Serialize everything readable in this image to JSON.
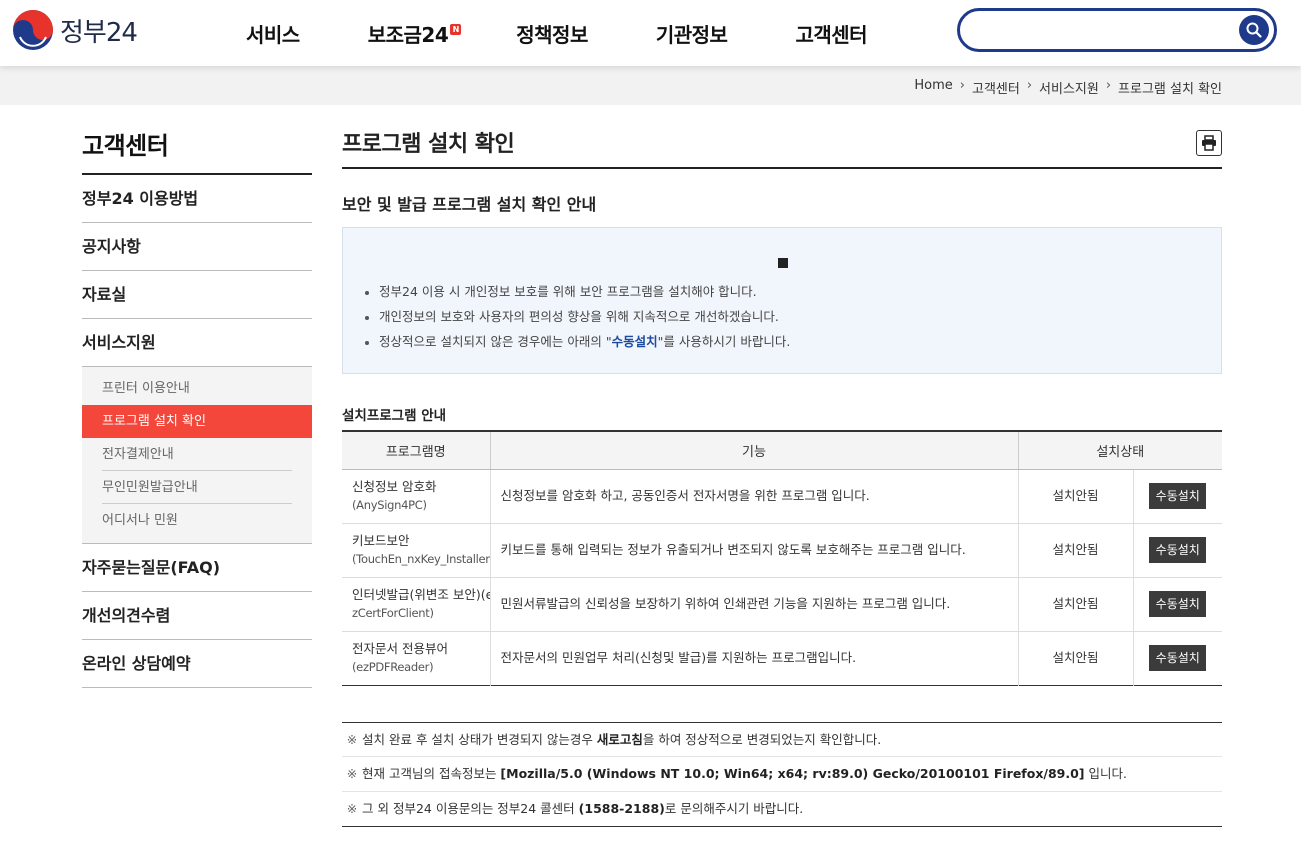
{
  "header": {
    "logo_text": "정부24",
    "nav": [
      {
        "label": "서비스",
        "badge": ""
      },
      {
        "label": "보조금24",
        "badge": "N"
      },
      {
        "label": "정책정보",
        "badge": ""
      },
      {
        "label": "기관정보",
        "badge": ""
      },
      {
        "label": "고객센터",
        "badge": ""
      }
    ],
    "search": {
      "placeholder": "",
      "value": ""
    }
  },
  "breadcrumb": [
    "Home",
    "고객센터",
    "서비스지원",
    "프로그램 설치 확인"
  ],
  "sidebar": {
    "title": "고객센터",
    "items_top": [
      "정부24 이용방법",
      "공지사항",
      "자료실",
      "서비스지원"
    ],
    "sub_items": [
      "프린터 이용안내",
      "프로그램 설치 확인",
      "전자결제안내",
      "무인민원발급안내",
      "어디서나 민원"
    ],
    "active_sub": 1,
    "items_bottom": [
      "자주묻는질문(FAQ)",
      "개선의견수렴",
      "온라인 상담예약"
    ]
  },
  "main": {
    "title": "프로그램 설치 확인",
    "section_title": "보안 및 발급 프로그램 설치 확인 안내",
    "info": [
      {
        "text": "정부24 이용 시 개인정보 보호를 위해 보안 프로그램을 설치해야 합니다."
      },
      {
        "text": "개인정보의 보호와 사용자의 편의성 향상을 위해 지속적으로 개선하겠습니다."
      },
      {
        "before": "정상적으로 설치되지 않은 경우에는 아래의 \"",
        "highlight": "수동설치",
        "after": "\"를 사용하시기 바랍니다."
      }
    ],
    "table_title": "설치프로그램 안내",
    "table_headers": [
      "프로그램명",
      "기능",
      "설치상태"
    ],
    "rows": [
      {
        "name": "신청정보 암호화",
        "sub": "(AnySign4PC)",
        "desc": "신청정보를 암호화 하고, 공동인증서 전자서명을 위한 프로그램 입니다.",
        "status": "설치안됨",
        "button": "수동설치"
      },
      {
        "name": "키보드보안",
        "sub": "(TouchEn_nxKey_Installer)",
        "desc": "키보드를 통해 입력되는 정보가 유출되거나 변조되지 않도록 보호해주는 프로그램 입니다.",
        "status": "설치안됨",
        "button": "수동설치"
      },
      {
        "name": "인터넷발급(위변조 보안)(e",
        "sub": "zCertForClient)",
        "desc": "민원서류발급의 신뢰성을 보장하기 위하여 인쇄관련 기능을 지원하는 프로그램 입니다.",
        "status": "설치안됨",
        "button": "수동설치"
      },
      {
        "name": "전자문서 전용뷰어",
        "sub": "(ezPDFReader)",
        "desc": "전자문서의 민원업무 처리(신청및 발급)를 지원하는 프로그램입니다.",
        "status": "설치안됨",
        "button": "수동설치"
      }
    ],
    "notes_mark": "※",
    "notes": [
      {
        "before": "설치 완료 후 설치 상태가 변경되지 않는경우 ",
        "bold": "새로고침",
        "after": "을 하여 정상적으로 변경되었는지 확인합니다."
      },
      {
        "before": "현재 고객님의 접속정보는 ",
        "bold": "[Mozilla/5.0 (Windows NT 10.0; Win64; x64; rv:89.0) Gecko/20100101 Firefox/89.0]",
        "after": " 입니다."
      },
      {
        "before": "그 외 정부24 이용문의는 정부24 콜센터 ",
        "bold": "(1588-2188)",
        "after": "로 문의해주시기 바랍니다."
      }
    ]
  },
  "colors": {
    "brand_navy": "#1f3a8a",
    "active_red": "#f2473a",
    "highlight_blue": "#1c4ba0"
  }
}
